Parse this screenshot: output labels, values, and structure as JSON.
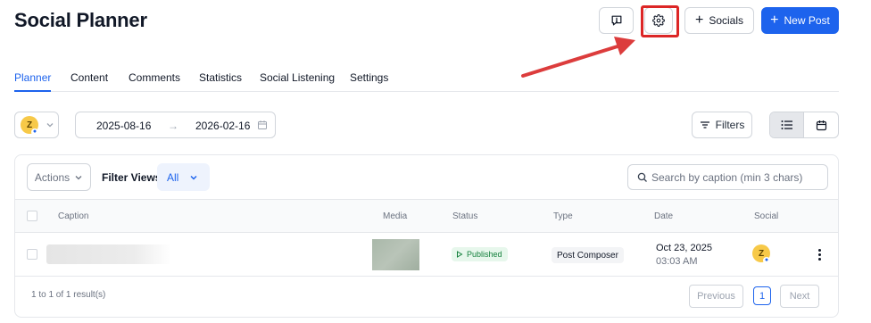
{
  "header": {
    "title": "Social Planner",
    "socials_label": "Socials",
    "new_post_label": "New Post"
  },
  "tabs": [
    {
      "label": "Planner",
      "active": true
    },
    {
      "label": "Content"
    },
    {
      "label": "Comments"
    },
    {
      "label": "Statistics"
    },
    {
      "label": "Social Listening"
    },
    {
      "label": "Settings"
    }
  ],
  "toolbar": {
    "account_avatar_letter": "Z",
    "date_from": "2025-08-16",
    "date_to": "2026-02-16",
    "filters_label": "Filters"
  },
  "table_controls": {
    "actions_label": "Actions",
    "filter_views_label": "Filter Views:",
    "filter_views_value": "All",
    "search_placeholder": "Search by caption (min 3 chars)"
  },
  "table": {
    "columns": [
      "Caption",
      "Media",
      "Status",
      "Type",
      "Date",
      "Social"
    ],
    "rows": [
      {
        "status": "Published",
        "type": "Post Composer",
        "date": "Oct 23, 2025",
        "time": "03:03 AM",
        "social_avatar_letter": "Z"
      }
    ]
  },
  "pagination": {
    "result_text": "1 to 1 of 1 result(s)",
    "previous_label": "Previous",
    "current_page": "1",
    "next_label": "Next"
  },
  "colors": {
    "accent": "#1d63ed",
    "highlight_box": "#dc2626",
    "published": "#15803d"
  }
}
